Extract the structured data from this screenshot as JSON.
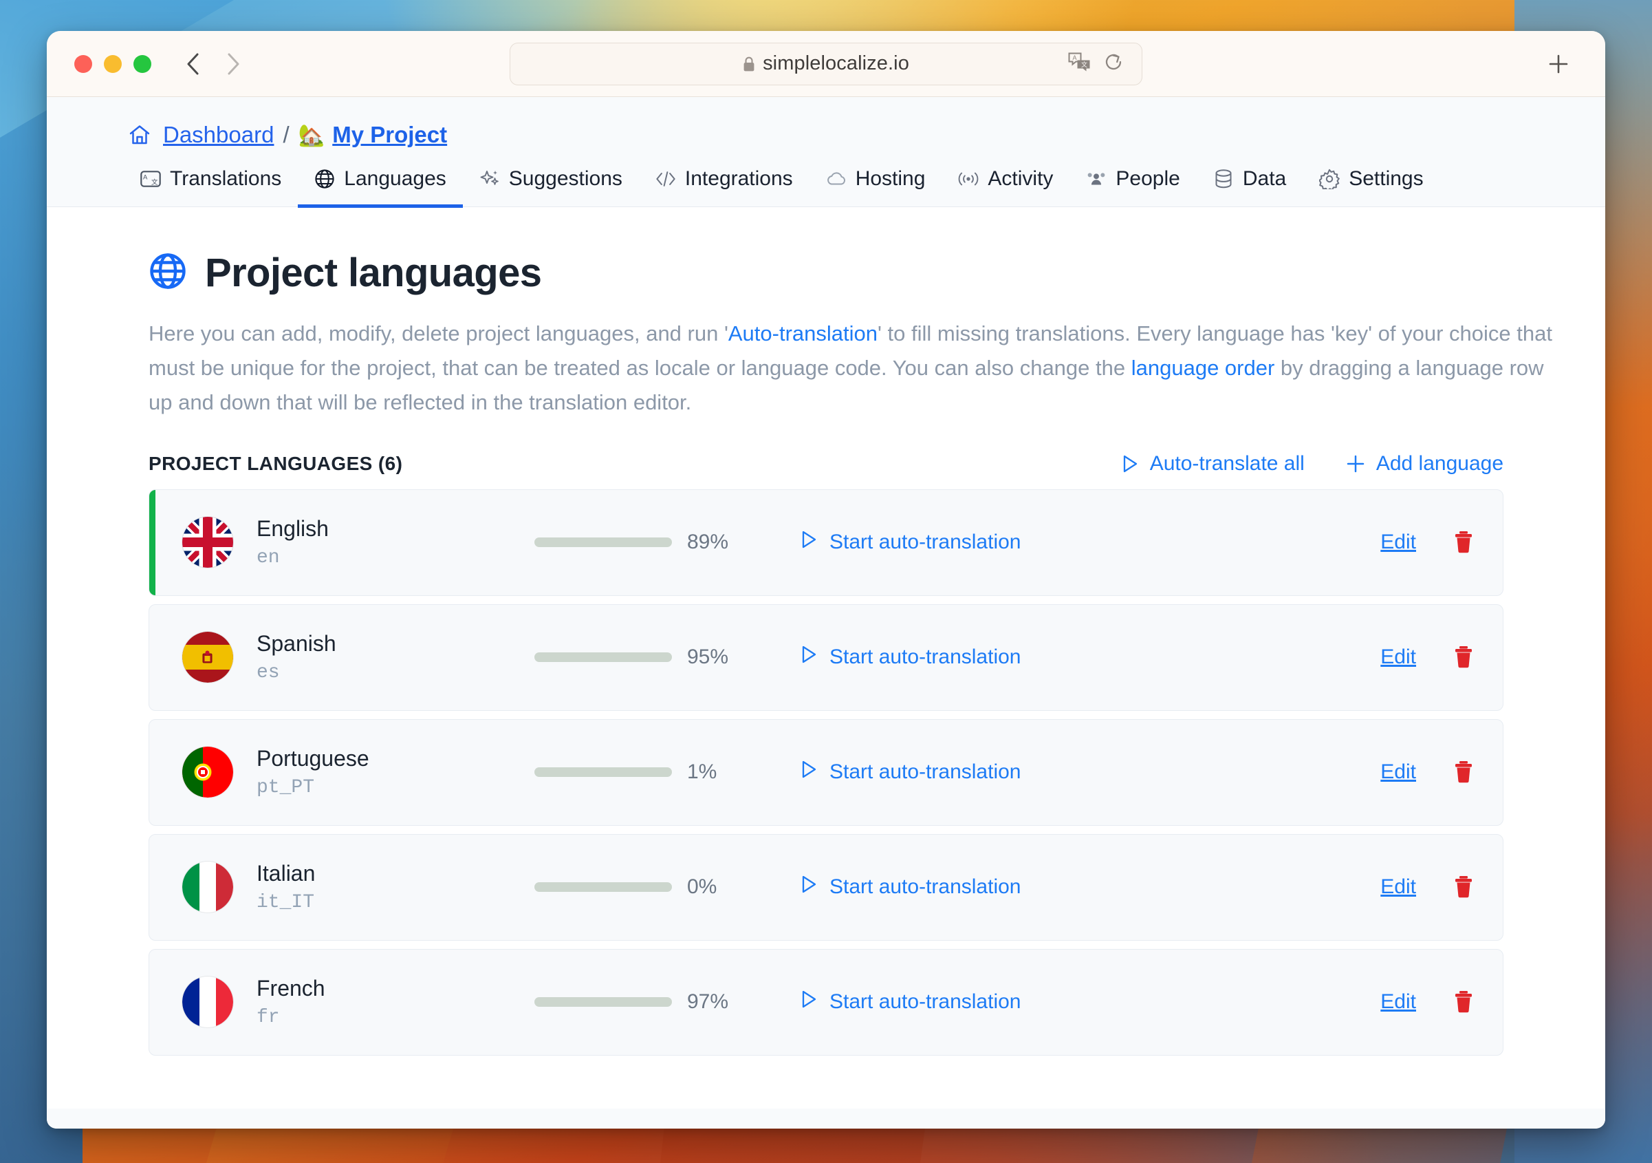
{
  "browser": {
    "url": "simplelocalize.io",
    "lock_icon": "lock-icon",
    "back_icon": "back-chevron-icon",
    "forward_icon": "forward-chevron-icon",
    "translate_icon": "translate-icon",
    "reload_icon": "reload-icon",
    "newtab_icon": "plus-icon"
  },
  "breadcrumb": {
    "home_icon": "home-icon",
    "dashboard": "Dashboard",
    "separator": "/",
    "project_emoji": "🏡",
    "project": "My Project"
  },
  "tabs": [
    {
      "label": "Translations",
      "icon": "translations-icon",
      "active": false
    },
    {
      "label": "Languages",
      "icon": "globe-icon",
      "active": true
    },
    {
      "label": "Suggestions",
      "icon": "sparkles-icon",
      "active": false
    },
    {
      "label": "Integrations",
      "icon": "code-icon",
      "active": false
    },
    {
      "label": "Hosting",
      "icon": "cloud-icon",
      "active": false
    },
    {
      "label": "Activity",
      "icon": "broadcast-icon",
      "active": false
    },
    {
      "label": "People",
      "icon": "people-icon",
      "active": false
    },
    {
      "label": "Data",
      "icon": "database-icon",
      "active": false
    },
    {
      "label": "Settings",
      "icon": "gear-icon",
      "active": false
    }
  ],
  "page": {
    "title": "Project languages",
    "title_icon": "globe-icon",
    "description_parts": {
      "p1": "Here you can add, modify, delete project languages, and run '",
      "link1": "Auto-translation",
      "p2": "' to fill missing translations. Every language has 'key' of your choice that must be unique for the project, that can be treated as locale or language code. You can also change the ",
      "link2": "language order",
      "p3": " by dragging a language row up and down that will be reflected in the translation editor."
    }
  },
  "section": {
    "title": "PROJECT LANGUAGES (6)",
    "auto_translate_all": "Auto-translate all",
    "add_language": "Add language",
    "play_icon": "play-icon",
    "plus_icon": "plus-icon"
  },
  "row_actions": {
    "start_auto_translation": "Start auto-translation",
    "edit": "Edit",
    "play_icon": "play-icon",
    "trash_icon": "trash-icon"
  },
  "colors": {
    "accent_blue": "#1d7bf5",
    "link_blue": "#2563eb",
    "progress_green": "#12b24a",
    "progress_track": "#ccd6cd",
    "delete_red": "#e0262a",
    "row_bg": "#f7f9fb"
  },
  "languages": [
    {
      "name": "English",
      "code": "en",
      "percent": 89,
      "percent_label": "89%",
      "flag": "gb",
      "accent": true
    },
    {
      "name": "Spanish",
      "code": "es",
      "percent": 95,
      "percent_label": "95%",
      "flag": "es",
      "accent": false
    },
    {
      "name": "Portuguese",
      "code": "pt_PT",
      "percent": 1,
      "percent_label": "1%",
      "flag": "pt",
      "accent": false
    },
    {
      "name": "Italian",
      "code": "it_IT",
      "percent": 0,
      "percent_label": "0%",
      "flag": "it",
      "accent": false
    },
    {
      "name": "French",
      "code": "fr",
      "percent": 97,
      "percent_label": "97%",
      "flag": "fr",
      "accent": false
    }
  ]
}
